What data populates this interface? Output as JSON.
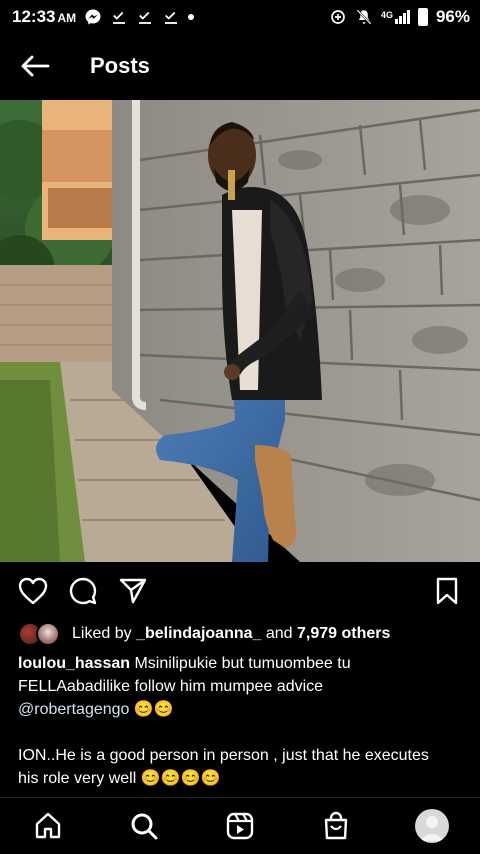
{
  "status_bar": {
    "time": "12:33",
    "ampm": "AM",
    "network": "4G",
    "battery": "96%",
    "icons": [
      "messenger-icon",
      "check-download-icon",
      "check-download-icon",
      "check-download-icon",
      "dot-icon",
      "data-saver-icon",
      "mute-icon",
      "signal-icon",
      "battery-icon"
    ]
  },
  "header": {
    "title": "Posts",
    "back_icon": "arrow-left-icon"
  },
  "post": {
    "image_alt": "Man in black leather jacket and jeans leaning against a stone wall",
    "actions": [
      "heart-icon",
      "comment-icon",
      "share-icon",
      "bookmark-icon"
    ],
    "likes": {
      "prefix": "Liked by ",
      "user": "_belindajoanna_",
      "middle": " and ",
      "count": "7,979 others"
    },
    "caption": {
      "username": "loulou_hassan",
      "line1": " Msinilipukie but tumuombee tu",
      "line2": "FELLAabadilike follow him mumpee advice",
      "mention": "@robertagengo",
      "mention_suffix": " 😊😊",
      "line4": "ION..He is a good person in person , just that he executes",
      "line5": "his role very well 😊😊😊😊"
    }
  },
  "bottom_nav": [
    "home-icon",
    "search-icon",
    "reels-icon",
    "shop-icon",
    "profile-avatar"
  ],
  "colors": {
    "background": "#000000",
    "text": "#ffffff",
    "divider": "#262626"
  }
}
